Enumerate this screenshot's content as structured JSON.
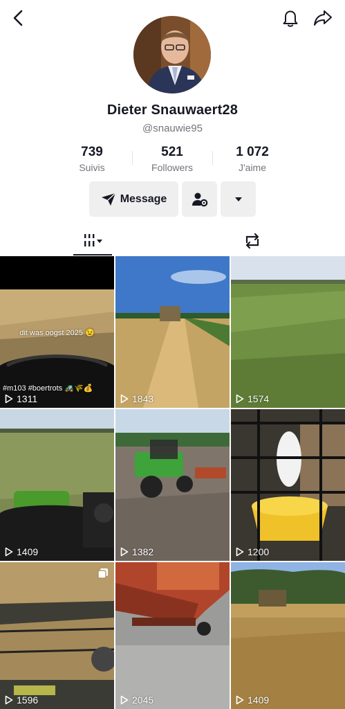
{
  "profile": {
    "display_name": "Dieter Snauwaert28",
    "username": "@snauwie95"
  },
  "stats": [
    {
      "value": "739",
      "label": "Suivis"
    },
    {
      "value": "521",
      "label": "Followers"
    },
    {
      "value": "1 072",
      "label": "J'aime"
    }
  ],
  "actions": {
    "message_label": "Message"
  },
  "icons": {
    "back": "back-arrow-icon",
    "bell": "bell-icon",
    "share": "share-arrow-icon",
    "message": "send-plane-icon",
    "add_friend": "person-settings-icon",
    "more": "caret-down-icon",
    "videos_tab": "grid-bars-icon",
    "reposts_tab": "repost-icon",
    "play": "play-outline-icon"
  },
  "videos": [
    {
      "views": "1311",
      "caption": "dit was oogst 2025 😉",
      "tags": "#m103 #boertrots 🚜🌾💰"
    },
    {
      "views": "1843"
    },
    {
      "views": "1574"
    },
    {
      "views": "1409"
    },
    {
      "views": "1382"
    },
    {
      "views": "1200"
    },
    {
      "views": "1596"
    },
    {
      "views": "2045"
    },
    {
      "views": "1409"
    }
  ],
  "colors": {
    "text_primary": "#161823",
    "text_secondary": "#73747b",
    "button_bg": "#efeff0"
  }
}
